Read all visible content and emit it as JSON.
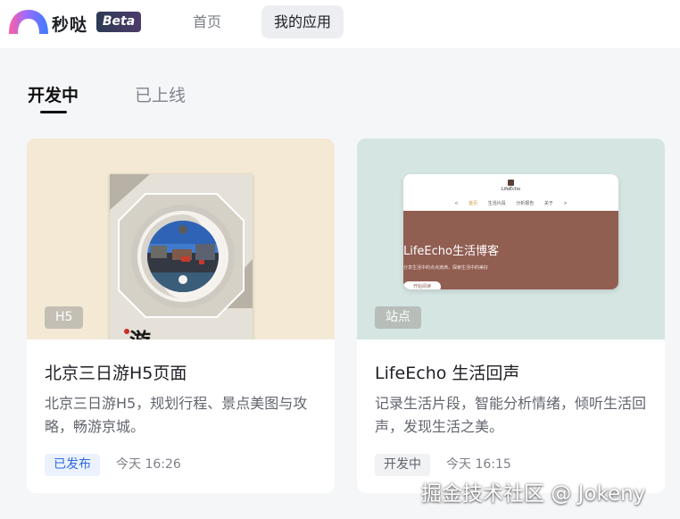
{
  "header": {
    "brand": "秒哒",
    "badge": "Beta",
    "nav": [
      {
        "label": "首页"
      },
      {
        "label": "我的应用"
      }
    ]
  },
  "tabs": [
    {
      "label": "开发中",
      "active": true
    },
    {
      "label": "已上线",
      "active": false
    }
  ],
  "cards": [
    {
      "type": "H5",
      "title": "北京三日游H5页面",
      "description": "北京三日游H5，规划行程、景点美图与攻略，畅游京城。",
      "status": "已发布",
      "time": "今天 16:26"
    },
    {
      "type": "站点",
      "title": "LifeEcho 生活回声",
      "description": "记录生活片段，智能分析情绪，倾听生活回声，发现生活之美。",
      "status": "开发中",
      "time": "今天 16:15",
      "preview": {
        "site_name": "LifeEcho",
        "nav": [
          "<",
          "首页",
          "生活片段",
          "分析报告",
          "关于",
          ">"
        ],
        "hero_title": "LifeEcho生活博客",
        "hero_subtitle": "分享生活中的点点滴滴，探索生活中的美好",
        "hero_button": "开始阅读"
      }
    }
  ],
  "watermark": "掘金技术社区 @ Jokeny",
  "colors": {
    "accent": "#2f6bdc",
    "page_bg": "#f5f6f8",
    "card1_cover": "#f4e9d5",
    "card2_cover": "#d4e5e2",
    "preview_hero": "#915e52"
  }
}
